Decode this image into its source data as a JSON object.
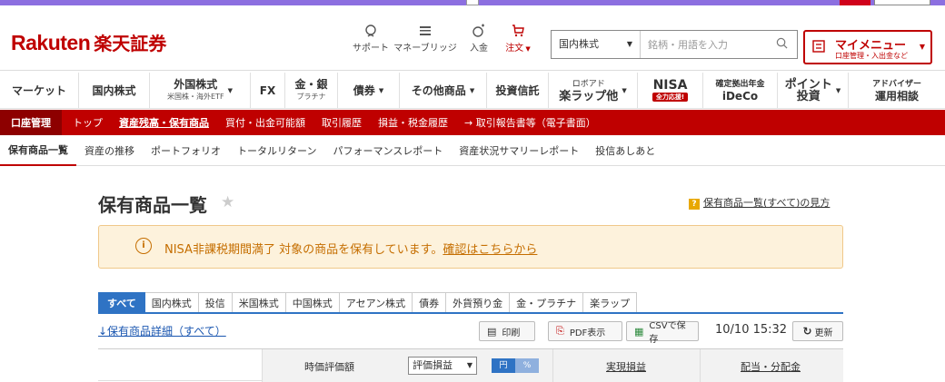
{
  "brand": {
    "logo_en": "Rakuten",
    "logo_jp": "楽天証券"
  },
  "header": {
    "icons": [
      {
        "label": "サポート",
        "icon": "support-icon"
      },
      {
        "label": "マネーブリッジ",
        "icon": "bank-icon"
      },
      {
        "label": "入金",
        "icon": "deposit-icon"
      },
      {
        "label": "注文",
        "icon": "cart-icon"
      }
    ],
    "search": {
      "category": "国内株式",
      "placeholder": "銘柄・用語を入力"
    },
    "mymenu": {
      "title": "マイメニュー",
      "subtitle": "口座管理・入出金など"
    }
  },
  "mainnav": {
    "items": [
      {
        "label": "マーケット"
      },
      {
        "label": "国内株式"
      },
      {
        "label": "外国株式",
        "sub": "米国株・海外ETF"
      },
      {
        "label": "FX"
      },
      {
        "label": "金・銀",
        "sub": "プラチナ"
      },
      {
        "label": "債券"
      },
      {
        "label": "その他商品"
      },
      {
        "label": "投資信託"
      },
      {
        "label": "ロボアド",
        "sub": "楽ラップ他"
      },
      {
        "label": "NISA",
        "badge": "全力応援!"
      },
      {
        "label": "確定拠出年金",
        "sub": "iDeCo"
      },
      {
        "label": "ポイント",
        "sub": "投資"
      },
      {
        "label": "アドバイザー",
        "sub": "運用相談"
      }
    ]
  },
  "redbar": {
    "label": "口座管理",
    "items": [
      "トップ",
      "資産残高・保有商品",
      "買付・出金可能額",
      "取引履歴",
      "損益・税金履歴",
      "→ 取引報告書等（電子書面）"
    ]
  },
  "subnav": {
    "items": [
      "保有商品一覧",
      "資産の推移",
      "ポートフォリオ",
      "トータルリターン",
      "パフォーマンスレポート",
      "資産状況サマリーレポート",
      "投信あしあと"
    ]
  },
  "page": {
    "title": "保有商品一覧",
    "howto": "保有商品一覧(すべて)の見方",
    "howto_q": "?"
  },
  "alert": {
    "icon": "i",
    "text": "NISA非課税期間満了 対象の商品を保有しています。",
    "link": "確認はこちらから"
  },
  "tabs": [
    "すべて",
    "国内株式",
    "投信",
    "米国株式",
    "中国株式",
    "アセアン株式",
    "債券",
    "外貨預り金",
    "金・プラチナ",
    "楽ラップ"
  ],
  "toolbar": {
    "detail_link": "↓保有商品詳細（すべて）",
    "print": "印刷",
    "pdf": "PDF表示",
    "csv": "CSVで保存",
    "datetime": "10/10 15:32",
    "refresh": "更新"
  },
  "table": {
    "col_valuation": "時価評価額",
    "select_value": "評価損益",
    "currency_yen": "円",
    "currency_pct": "%",
    "col_realized": "実現損益",
    "col_dividend": "配当・分配金"
  }
}
